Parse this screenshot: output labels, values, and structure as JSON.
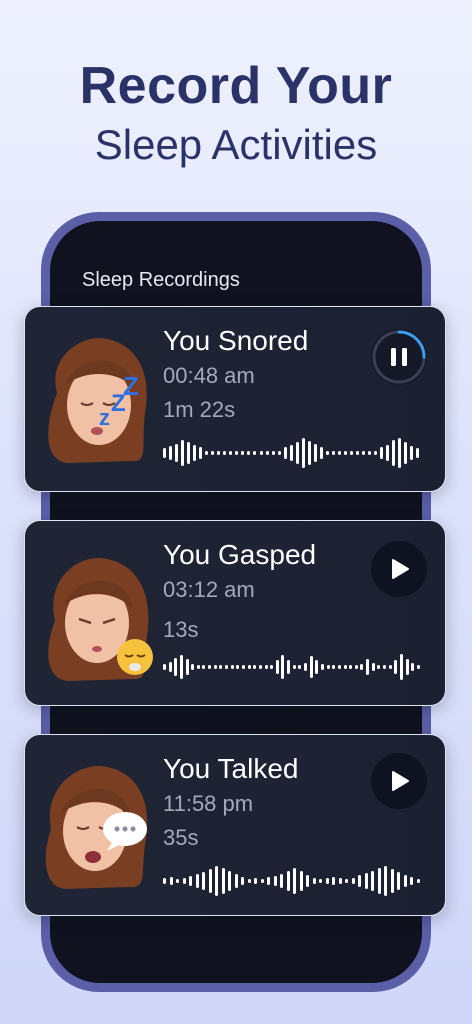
{
  "headline": {
    "line1": "Record Your",
    "line2": "Sleep Activities"
  },
  "screen": {
    "title": "Sleep Recordings"
  },
  "recordings": [
    {
      "title": "You Snored",
      "time": "00:48 am",
      "duration": "1m 22s",
      "state": "playing",
      "progress": 0.25,
      "avatar": "avatar-snoring",
      "badge_icon": "zzz-icon"
    },
    {
      "title": "You Gasped",
      "time": "03:12 am",
      "duration": "13s",
      "state": "paused",
      "avatar": "avatar-gasping",
      "badge_icon": "gasp-emoji-icon"
    },
    {
      "title": "You Talked",
      "time": "11:58 pm",
      "duration": "35s",
      "state": "paused",
      "avatar": "avatar-talking",
      "badge_icon": "speech-bubble-icon"
    }
  ],
  "colors": {
    "headline": "#2b3268",
    "phone_frame": "#5a5fa8",
    "card_bg": "#202536",
    "progress_ring": "#3d9bf0",
    "secondary_text": "#a5a9bb"
  }
}
